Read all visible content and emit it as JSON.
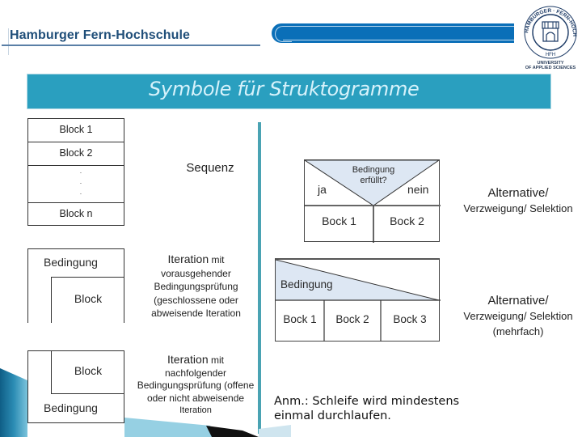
{
  "header": {
    "brand": "Hamburger Fern-Hochschule",
    "logo": {
      "ring_text": "HAMBURGER · FERN-HOCHSCHULE",
      "abbr": "HFH",
      "subtitle_line1": "UNIVERSITY",
      "subtitle_line2": "OF APPLIED SCIENCES"
    },
    "colors": {
      "brand_text": "#1f4e79",
      "bar": "#0a6fb8"
    }
  },
  "title": {
    "text": "Symbole für Struktogramme",
    "background": "#2a9fbf",
    "color": "#d6f2fb"
  },
  "left_column": {
    "sequence": {
      "blocks": [
        "Block 1",
        "Block 2",
        "Block n"
      ],
      "ellipsis": "·\n·\n·",
      "label": "Sequenz"
    },
    "iteration_pre": {
      "condition": "Bedingung",
      "block": "Block",
      "label_main": "Iteration",
      "label_lines": [
        "mit",
        "vorausgehender",
        "Bedingungsprüfung",
        "(geschlossene oder",
        "abweisende Iteration"
      ]
    },
    "iteration_post": {
      "condition": "Bedingung",
      "block": "Block",
      "label_main": "Iteration",
      "label_lines": [
        "mit",
        "nachfolgender",
        "Bedingungsprüfung (offene",
        "oder nicht abweisende",
        "Iteration"
      ]
    }
  },
  "right_column": {
    "alternative": {
      "condition_line1": "Bedingung",
      "condition_line2": "erfüllt?",
      "yes": "ja",
      "no": "nein",
      "blocks": [
        "Bock 1",
        "Bock 2"
      ],
      "label_line1": "Alternative/",
      "label_line2": "Verzweigung/ Selektion"
    },
    "multi_alternative": {
      "condition": "Bedingung",
      "blocks": [
        "Bock 1",
        "Bock 2",
        "Bock 3"
      ],
      "label_line1": "Alternative/",
      "label_line2": "Verzweigung/ Selektion",
      "label_line3": "(mehrfach)"
    },
    "note_line1": "Anm.: Schleife wird mindestens",
    "note_line2": "einmal durchlaufen."
  },
  "accent": {
    "divider": "#4aa3b3",
    "condition_fill": "#dde7f3"
  }
}
